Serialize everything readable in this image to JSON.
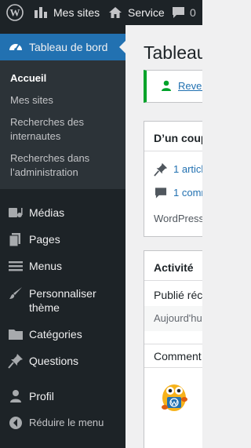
{
  "adminbar": {
    "wp_logo_icon": "wordpress-logo-icon",
    "my_sites_label": "Mes sites",
    "home_icon": "home-icon",
    "site_label": "Service",
    "comments_icon": "comment-bubble-icon",
    "comments_count": "0"
  },
  "sidebar": {
    "dashboard": {
      "label": "Tableau de bord",
      "icon": "dashboard-icon"
    },
    "submenu": [
      {
        "label": "Accueil"
      },
      {
        "label": "Mes sites"
      },
      {
        "label": "Recherches des internautes"
      },
      {
        "label": "Recherches dans l’administration"
      }
    ],
    "items": [
      {
        "label": "Médias",
        "icon": "media-icon"
      },
      {
        "label": "Pages",
        "icon": "pages-icon"
      },
      {
        "label": "Menus",
        "icon": "menu-icon"
      },
      {
        "label": "Personnaliser thème",
        "icon": "brush-icon"
      },
      {
        "label": "Catégories",
        "icon": "folder-icon"
      },
      {
        "label": "Questions",
        "icon": "pin-icon"
      },
      {
        "label": "Profil",
        "icon": "user-icon"
      },
      {
        "label": "Réduire le menu",
        "icon": "collapse-icon"
      }
    ]
  },
  "main": {
    "title": "Tableau",
    "notice_link": "Reven",
    "glance": {
      "title": "D’un coup",
      "posts_text": "1 articl",
      "comments_text": "1 comm",
      "wp_text": "WordPress"
    },
    "activity": {
      "title": "Activité",
      "published_label": "Publié réc",
      "today_label": "Aujourd'hu",
      "comments_label": "Comment"
    }
  },
  "colors": {
    "accent": "#2271b1",
    "adminbar": "#1d2327",
    "submenu": "#2c3338",
    "notice_green": "#00a32a"
  }
}
